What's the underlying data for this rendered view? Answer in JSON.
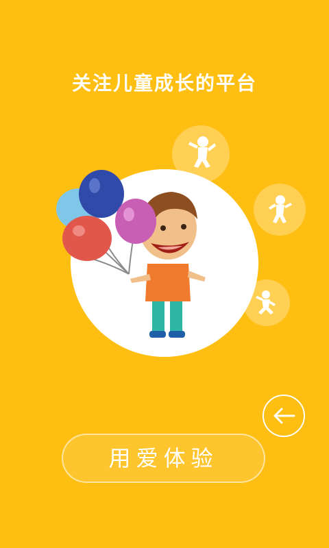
{
  "splash": {
    "headline": "关注儿童成长的平台",
    "cta_label": "用爱体验"
  },
  "colors": {
    "background": "#FFBE12",
    "white": "#FFFFFF"
  },
  "icons": {
    "back": "arrow-left-icon",
    "bubbles": [
      "child-jumping-icon",
      "child-dancing-icon",
      "child-playing-icon"
    ]
  }
}
